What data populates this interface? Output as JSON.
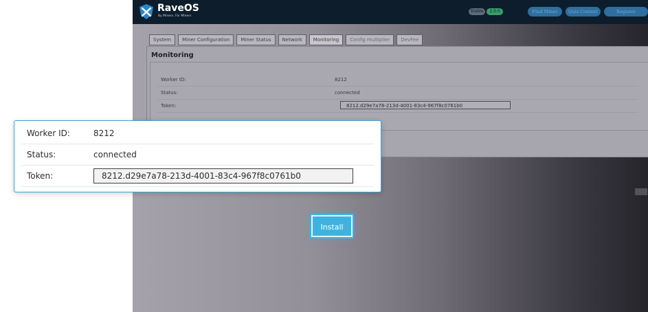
{
  "app": {
    "brand": "RaveOS",
    "tagline": "By Miners. For Miners",
    "badges": [
      "Stable",
      "1.0.0"
    ],
    "top_buttons": [
      "Find Miner",
      "Quiz Context",
      "Register"
    ],
    "tabs": [
      "System",
      "Miner Configuration",
      "Miner Status",
      "Network",
      "Monitoring",
      "Config multiplier",
      "DevFee"
    ],
    "active_tab": "Monitoring"
  },
  "monitoring": {
    "title": "Monitoring",
    "rows": [
      {
        "label": "Worker ID:",
        "value": "8212"
      },
      {
        "label": "Status:",
        "value": "connected"
      },
      {
        "label": "Token:",
        "value": "8212.d29e7a78-213d-4001-83c4-967f8c0761b0"
      }
    ]
  },
  "callout": {
    "rows": [
      {
        "label": "Worker ID:",
        "value": "8212"
      },
      {
        "label": "Status:",
        "value": "connected"
      },
      {
        "label": "Token:",
        "value": "8212.d29e7a78-213d-4001-83c4-967f8c0761b0"
      }
    ]
  },
  "install_button": "Install",
  "colors": {
    "topbar": "#0d1d2c",
    "accent": "#3fb3de",
    "callout_border": "#3ba4d6"
  },
  "icons": {
    "logo": "raveos-shield-logo"
  }
}
